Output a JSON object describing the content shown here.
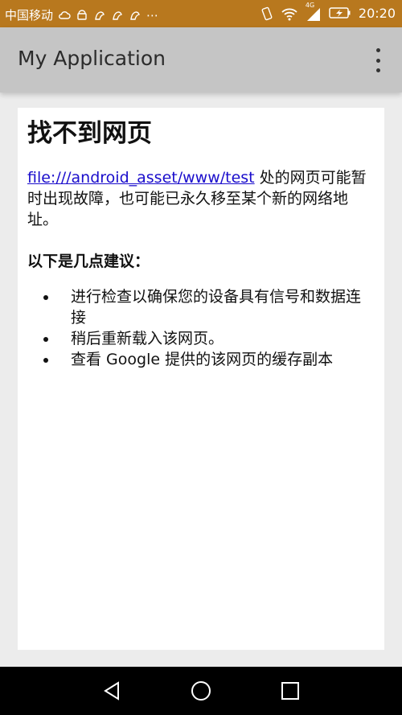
{
  "status_bar": {
    "carrier": "中国移动",
    "network_label": "4G",
    "time": "20:20",
    "background_color": "#b8781e",
    "icons_left": [
      "cloud-icon",
      "android-notification-icon",
      "app-notification-icon",
      "app-notification-icon",
      "app-notification-icon",
      "more-notifications-icon"
    ],
    "icons_right": [
      "vibrate-icon",
      "wifi-icon",
      "cellular-signal-icon",
      "battery-charging-icon"
    ]
  },
  "app_bar": {
    "title": "My Application",
    "menu_icon": "overflow-menu-icon",
    "background_color": "#c5c5c5"
  },
  "page": {
    "title": "找不到网页",
    "link_text": "file:///android_asset/www/test",
    "description_suffix": " 处的网页可能暂时出现故障，也可能已永久移至某个新的网络地址。",
    "suggestions_heading": "以下是几点建议：",
    "suggestions": [
      "进行检查以确保您的设备具有信号和数据连接",
      "稍后重新载入该网页。",
      "查看 Google 提供的该网页的缓存副本"
    ]
  },
  "nav_bar": {
    "buttons": [
      "back-icon",
      "home-icon",
      "recents-icon"
    ]
  }
}
